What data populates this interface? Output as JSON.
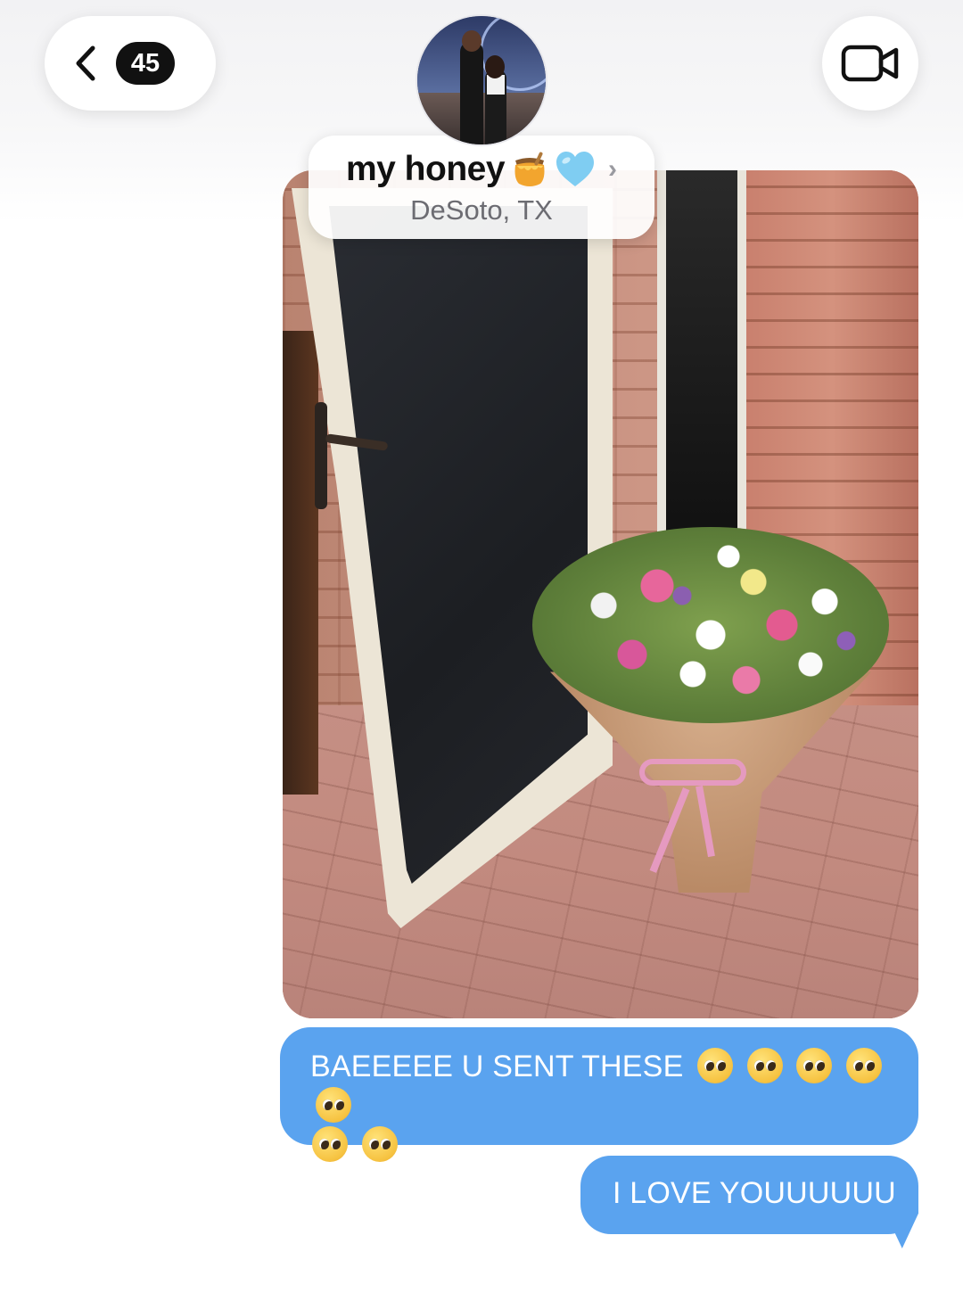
{
  "header": {
    "back_count": "45",
    "contact_name": "my honey",
    "name_emojis": [
      "honey-pot",
      "light-blue-heart"
    ],
    "location": "DeSoto, TX"
  },
  "messages": [
    {
      "type": "image",
      "from": "me",
      "content": "photo of a flower bouquet in brown paper with a pink ribbon on a brick porch beside an open screen door"
    },
    {
      "type": "text",
      "from": "me",
      "text": "BAEEEEE U SENT THESE",
      "emoji": "pleading-face",
      "emoji_count": 7
    },
    {
      "type": "text",
      "from": "me",
      "text": "I LOVE YOUUUUUU"
    }
  ],
  "colors": {
    "bubble_blue": "#5aa3ef",
    "badge_black": "#111111"
  }
}
